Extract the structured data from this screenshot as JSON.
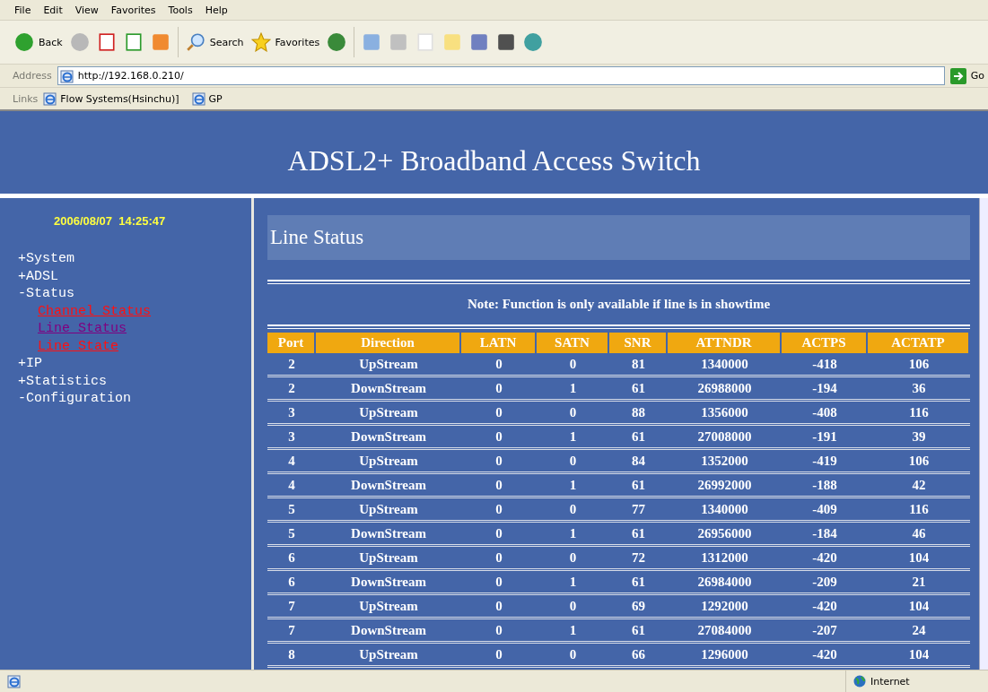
{
  "menu": [
    "File",
    "Edit",
    "View",
    "Favorites",
    "Tools",
    "Help"
  ],
  "toolbar": {
    "back": "Back",
    "search": "Search",
    "favorites": "Favorites"
  },
  "address": {
    "label": "Address",
    "value": "http://192.168.0.210/",
    "go": "Go"
  },
  "links": {
    "label": "Links",
    "items": [
      "Flow Systems(Hsinchu)]",
      "GP"
    ]
  },
  "page": {
    "title": "ADSL2+ Broadband Access Switch",
    "clock": "2006/08/07  14:25:47",
    "nav": [
      {
        "label": "+System"
      },
      {
        "label": "+ADSL"
      },
      {
        "label": "-Status",
        "children": [
          {
            "label": "Channel Status",
            "visited": false
          },
          {
            "label": "Line Status",
            "visited": true
          },
          {
            "label": "Line State",
            "visited": false
          }
        ]
      },
      {
        "label": "+IP"
      },
      {
        "label": "+Statistics"
      },
      {
        "label": "-Configuration"
      }
    ],
    "heading": "Line Status",
    "note": "Note: Function is only available if line is in showtime",
    "table": {
      "columns": [
        "Port",
        "Direction",
        "LATN",
        "SATN",
        "SNR",
        "ATTNDR",
        "ACTPS",
        "ACTATP"
      ],
      "rows": [
        [
          "2",
          "UpStream",
          "0",
          "0",
          "81",
          "1340000",
          "-418",
          "106"
        ],
        [
          "2",
          "DownStream",
          "0",
          "1",
          "61",
          "26988000",
          "-194",
          "36"
        ],
        [
          "3",
          "UpStream",
          "0",
          "0",
          "88",
          "1356000",
          "-408",
          "116"
        ],
        [
          "3",
          "DownStream",
          "0",
          "1",
          "61",
          "27008000",
          "-191",
          "39"
        ],
        [
          "4",
          "UpStream",
          "0",
          "0",
          "84",
          "1352000",
          "-419",
          "106"
        ],
        [
          "4",
          "DownStream",
          "0",
          "1",
          "61",
          "26992000",
          "-188",
          "42"
        ],
        [
          "5",
          "UpStream",
          "0",
          "0",
          "77",
          "1340000",
          "-409",
          "116"
        ],
        [
          "5",
          "DownStream",
          "0",
          "1",
          "61",
          "26956000",
          "-184",
          "46"
        ],
        [
          "6",
          "UpStream",
          "0",
          "0",
          "72",
          "1312000",
          "-420",
          "104"
        ],
        [
          "6",
          "DownStream",
          "0",
          "1",
          "61",
          "26984000",
          "-209",
          "21"
        ],
        [
          "7",
          "UpStream",
          "0",
          "0",
          "69",
          "1292000",
          "-420",
          "104"
        ],
        [
          "7",
          "DownStream",
          "0",
          "1",
          "61",
          "27084000",
          "-207",
          "24"
        ],
        [
          "8",
          "UpStream",
          "0",
          "0",
          "66",
          "1296000",
          "-420",
          "104"
        ]
      ]
    }
  },
  "status_bar": {
    "zone": "Internet"
  }
}
